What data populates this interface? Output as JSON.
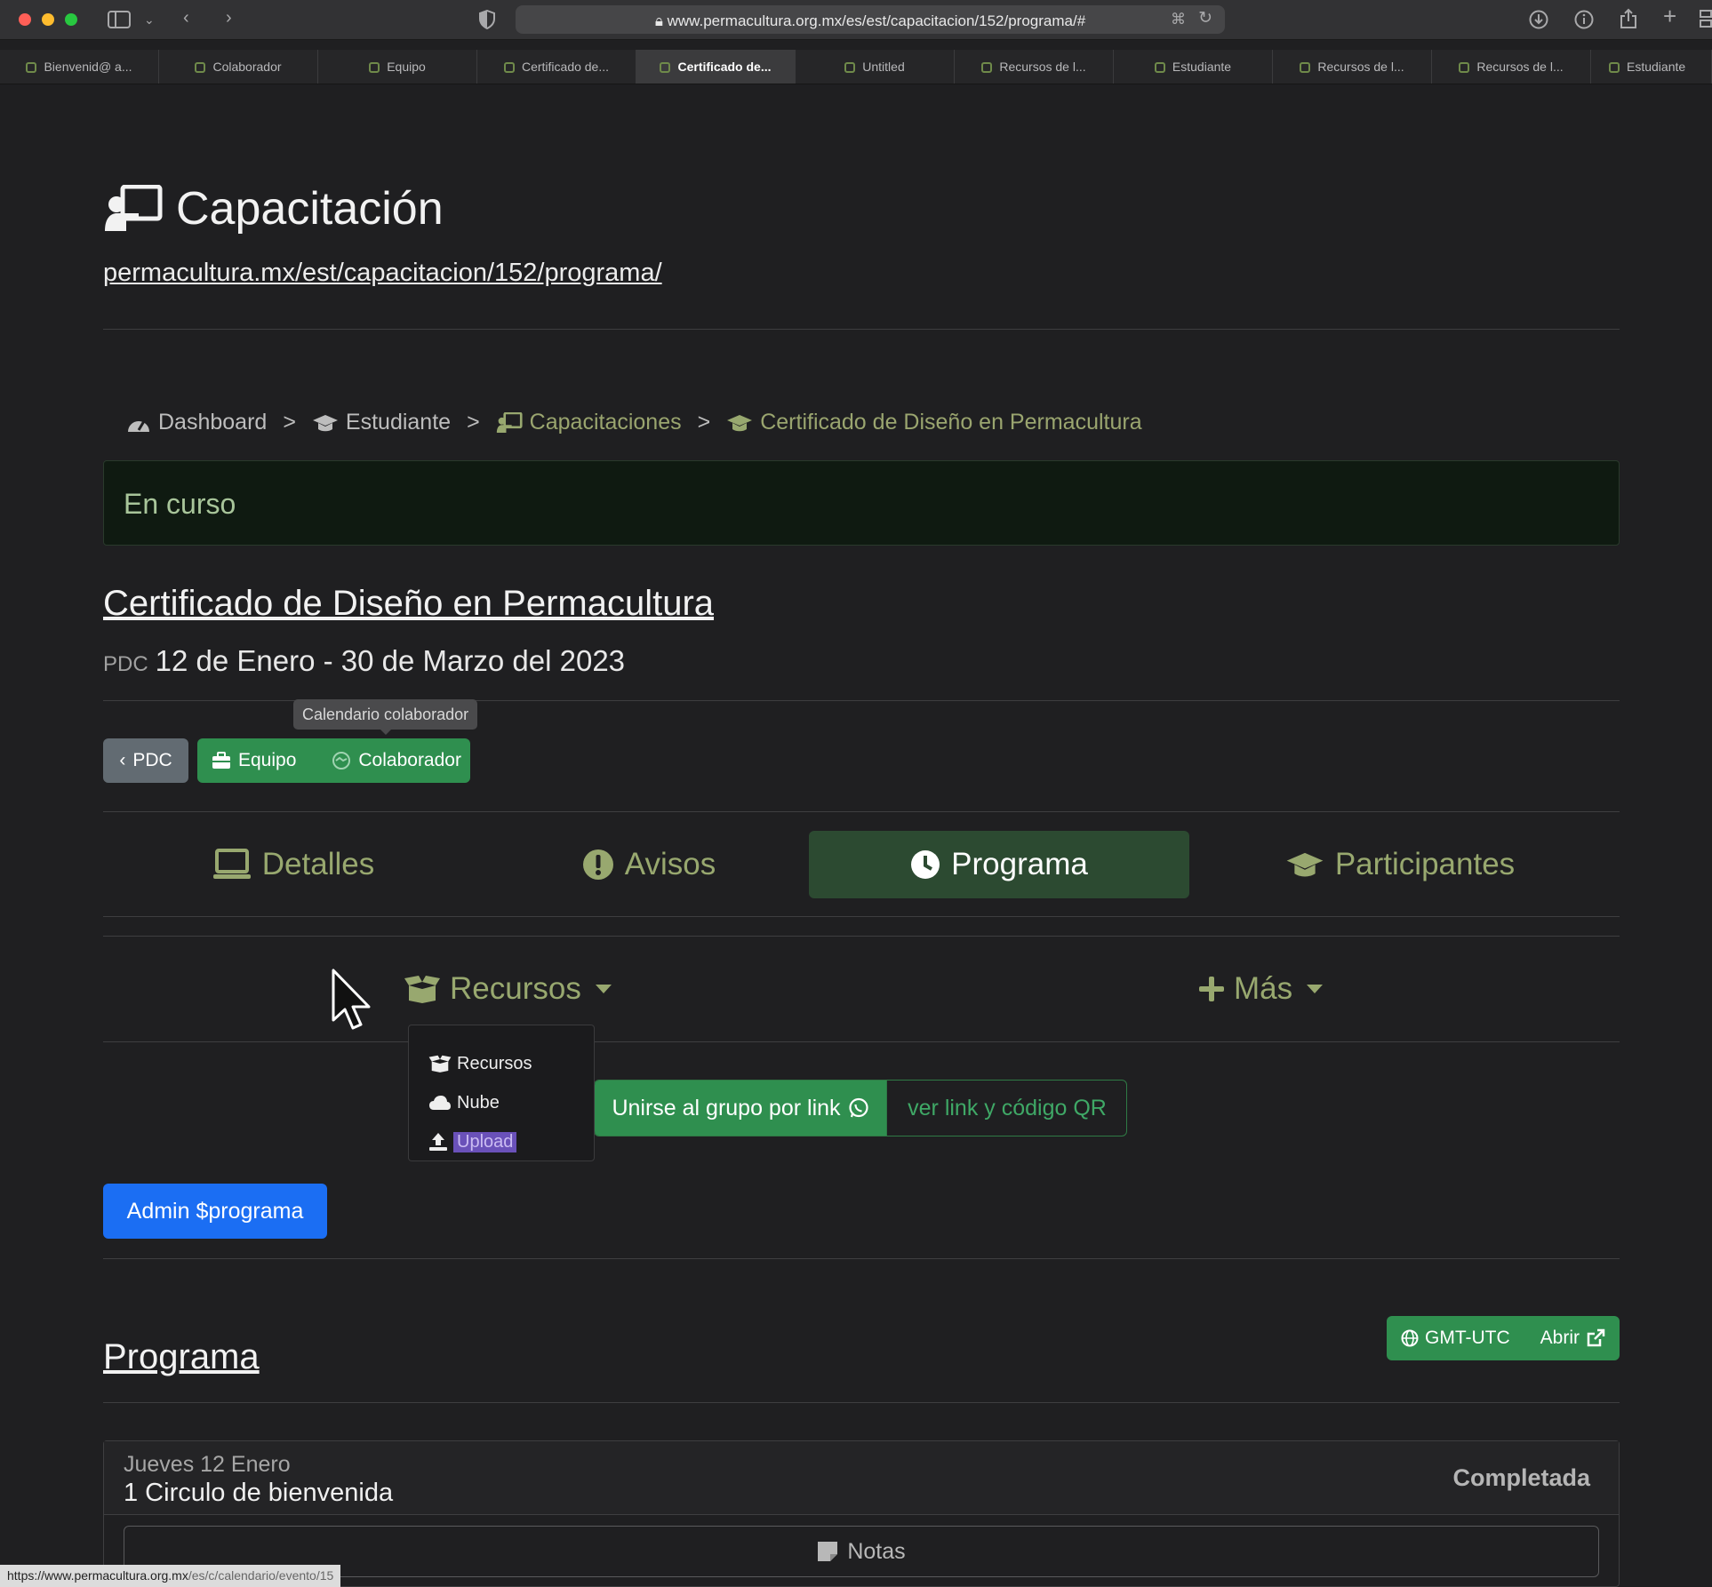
{
  "browser": {
    "url": "www.permacultura.org.mx/es/est/capacitacion/152/programa/#",
    "tabs": [
      {
        "label": "Bienvenid@ a..."
      },
      {
        "label": "Colaborador"
      },
      {
        "label": "Equipo"
      },
      {
        "label": "Certificado de..."
      },
      {
        "label": "Certificado de...",
        "active": true
      },
      {
        "label": "Untitled"
      },
      {
        "label": "Recursos de l..."
      },
      {
        "label": "Estudiante"
      },
      {
        "label": "Recursos de l..."
      },
      {
        "label": "Recursos de l..."
      },
      {
        "label": "Estudiante"
      }
    ],
    "status_url_main": "https://www.permacultura.org.mx",
    "status_url_path": "/es/c/calendario/evento/15"
  },
  "header": {
    "title": "Capacitación",
    "link": "permacultura.mx/est/capacitacion/152/programa/"
  },
  "breadcrumb": {
    "items": [
      "Dashboard",
      "Estudiante",
      "Capacitaciones",
      "Certificado de Diseño en Permacultura"
    ],
    "separator": ">"
  },
  "status": {
    "text": "En curso"
  },
  "course": {
    "title": "Certificado de Diseño en Permacultura",
    "code": "PDC",
    "dates": "12 de Enero - 30 de Marzo del 2023"
  },
  "actions": {
    "tooltip": "Calendario colaborador",
    "back_label": "PDC",
    "equipo_label": "Equipo",
    "colaborador_label": "Colaborador"
  },
  "tabs": [
    {
      "label": "Detalles",
      "icon": "laptop-icon"
    },
    {
      "label": "Avisos",
      "icon": "exclamation-circle-icon"
    },
    {
      "label": "Programa",
      "icon": "clock-icon",
      "active": true
    },
    {
      "label": "Participantes",
      "icon": "graduation-cap-icon"
    }
  ],
  "toolbar": {
    "recursos_label": "Recursos",
    "mas_label": "Más"
  },
  "recursos_menu": [
    {
      "label": "Recursos",
      "icon": "box-open-icon"
    },
    {
      "label": "Nube",
      "icon": "cloud-icon"
    },
    {
      "label": "Upload",
      "icon": "upload-icon",
      "highlighted": true
    }
  ],
  "group": {
    "join_label": "Unirse al grupo por link",
    "qr_label": "ver link y código QR"
  },
  "admin": {
    "label": "Admin $programa"
  },
  "programa": {
    "title": "Programa",
    "timezone_label": "GMT-UTC",
    "open_label": "Abrir"
  },
  "events": [
    {
      "date": "Jueves 12 Enero",
      "name": "1 Circulo de bienvenida",
      "status": "Completada",
      "notes_label": "Notas"
    }
  ],
  "colors": {
    "accent_green": "#2f8f4f",
    "olive_link": "#98a86f",
    "admin_blue": "#1b6ef3",
    "active_tab": "#2c4a31"
  }
}
